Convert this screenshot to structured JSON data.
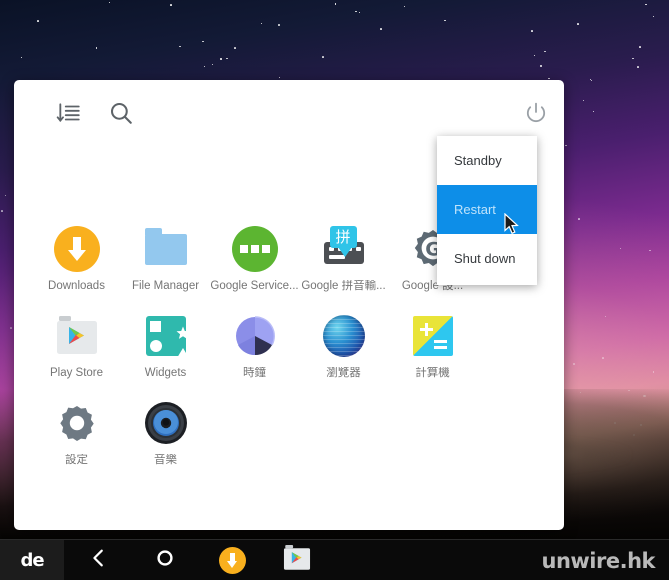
{
  "wallpaper": {
    "name": "night-sky-aurora-wallpaper",
    "top_color": "#0a1226",
    "mid_color": "#a53b9e",
    "bottom_color": "#0d0a09"
  },
  "launcher": {
    "toolbar": {
      "sort_icon": "sort-list-icon",
      "search_icon": "search-icon",
      "power_icon": "power-icon"
    },
    "apps": [
      {
        "id": "downloads",
        "label": "Downloads",
        "icon": "downloads-icon"
      },
      {
        "id": "file-manager",
        "label": "File Manager",
        "icon": "folder-icon"
      },
      {
        "id": "google-services",
        "label": "Google Service...",
        "icon": "google-services-icon"
      },
      {
        "id": "google-pinyin",
        "label": "Google 拼音輸...",
        "icon": "google-pinyin-ime-icon"
      },
      {
        "id": "google-settings",
        "label": "Google 設...",
        "icon": "google-settings-gear-icon"
      },
      {
        "id": "play-store",
        "label": "Play Store",
        "icon": "play-store-icon"
      },
      {
        "id": "widgets",
        "label": "Widgets",
        "icon": "widgets-icon"
      },
      {
        "id": "clock",
        "label": "時鐘",
        "icon": "clock-icon"
      },
      {
        "id": "browser",
        "label": "瀏覽器",
        "icon": "browser-globe-icon"
      },
      {
        "id": "calculator",
        "label": "計算機",
        "icon": "calculator-icon"
      },
      {
        "id": "settings",
        "label": "設定",
        "icon": "settings-icon"
      },
      {
        "id": "music",
        "label": "音樂",
        "icon": "music-speaker-icon"
      }
    ]
  },
  "power_menu": {
    "highlight_color": "#0d8ee8",
    "items": [
      {
        "id": "standby",
        "label": "Standby",
        "selected": false
      },
      {
        "id": "restart",
        "label": "Restart",
        "selected": true
      },
      {
        "id": "shut-down",
        "label": "Shut down",
        "selected": false
      }
    ]
  },
  "taskbar": {
    "logo": "de",
    "buttons": [
      {
        "id": "back",
        "icon": "back-chevron-icon"
      },
      {
        "id": "home",
        "icon": "home-circle-icon"
      },
      {
        "id": "downloads",
        "icon": "downloads-icon"
      },
      {
        "id": "play-store",
        "icon": "play-store-icon"
      }
    ]
  },
  "watermark": {
    "text": "unwire.hk"
  }
}
